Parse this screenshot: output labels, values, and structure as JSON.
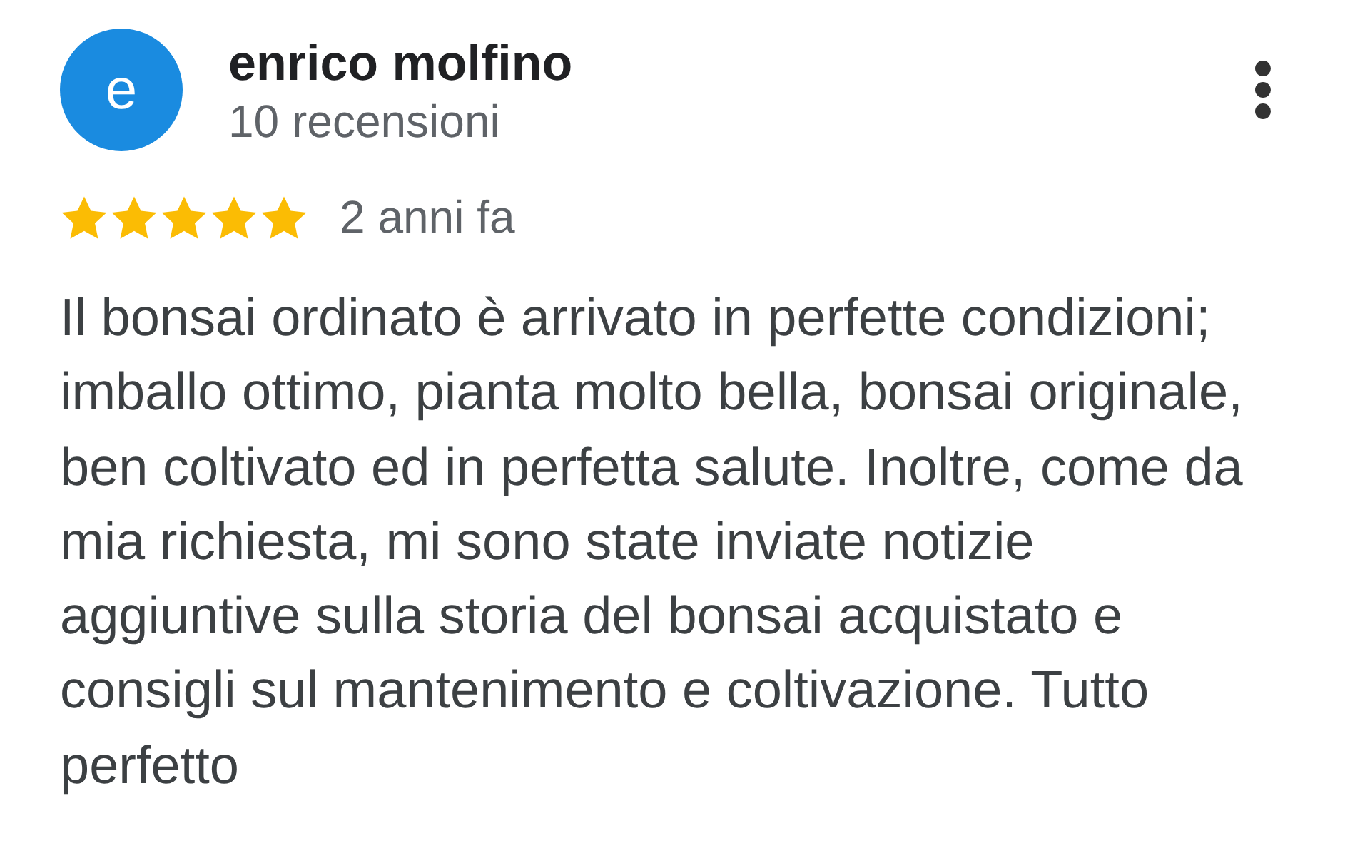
{
  "review": {
    "avatar_letter": "e",
    "author": "enrico molfino",
    "review_count": "10 recensioni",
    "stars": 5,
    "time": "2 anni fa",
    "text_lines": [
      "Il bonsai ordinato è arrivato in perfette condizioni;",
      "imballo ottimo, pianta molto bella, bonsai originale,",
      "ben coltivato ed in perfetta salute. Inoltre, come da",
      "mia richiesta, mi sono state inviate notizie",
      "aggiuntive sulla storia del bonsai acquistato e",
      "consigli sul mantenimento e coltivazione. Tutto",
      "perfetto"
    ]
  }
}
